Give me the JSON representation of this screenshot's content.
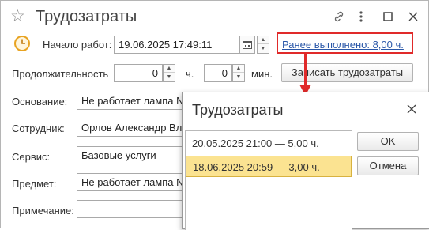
{
  "window": {
    "title": "Трудозатраты",
    "star_icon": "star-icon",
    "link_icon": "link-icon",
    "more_icon": "more-vertical-icon",
    "maximize_icon": "maximize-icon",
    "close_icon": "close-icon"
  },
  "form": {
    "start_label": "Начало работ:",
    "start_value": "19.06.2025 17:49:11",
    "previously_done_link": "Ранее выполнено: 8,00 ч.",
    "duration_label": "Продолжительность",
    "hours_value": "0",
    "hours_unit": "ч.",
    "minutes_value": "0",
    "minutes_unit": "мин.",
    "record_button": "Записать трудозатраты",
    "basis_label": "Основание:",
    "basis_value": "Не работает лампа N",
    "employee_label": "Сотрудник:",
    "employee_value": "Орлов Александр Вл",
    "service_label": "Сервис:",
    "service_value": "Базовые услуги",
    "subject_label": "Предмет:",
    "subject_value": "Не работает лампа N",
    "note_label": "Примечание:",
    "note_value": ""
  },
  "popup": {
    "title": "Трудозатраты",
    "close_icon": "close-icon",
    "items": [
      {
        "label": "20.05.2025 21:00 — 5,00 ч.",
        "selected": false
      },
      {
        "label": "18.06.2025 20:59 — 3,00 ч.",
        "selected": true
      }
    ],
    "ok_label": "OK",
    "cancel_label": "Отмена"
  },
  "colors": {
    "annotation_red": "#e02a2a",
    "link_blue": "#2a57a8",
    "selection_yellow": "#fbe391",
    "clock_orange": "#e8a321"
  }
}
